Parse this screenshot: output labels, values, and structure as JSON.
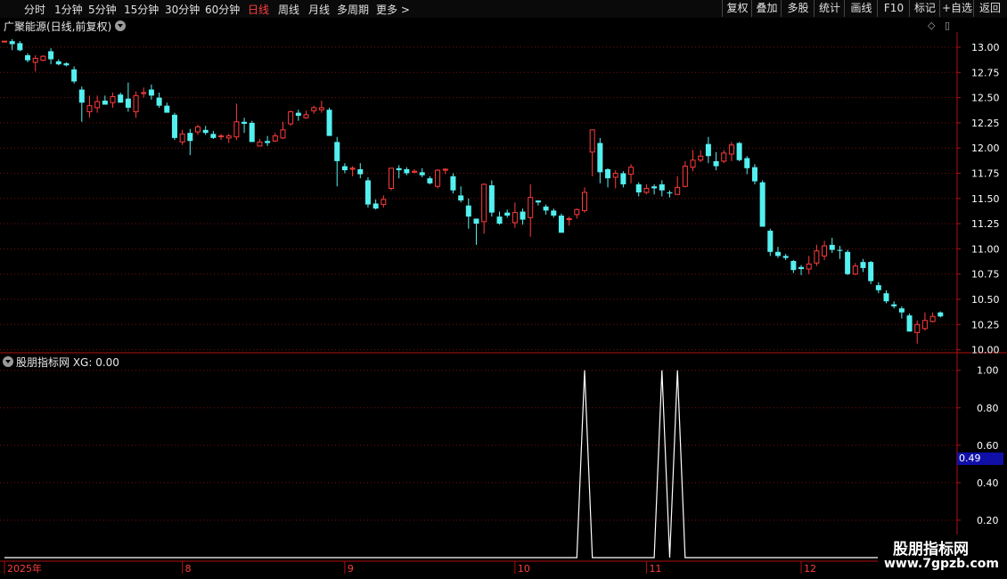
{
  "toolbar": {
    "periods": [
      "分时",
      "1分钟",
      "5分钟",
      "15分钟",
      "30分钟",
      "60分钟",
      "日线",
      "周线",
      "月线",
      "多周期",
      "更多 >"
    ],
    "active_period": "日线",
    "buttons": [
      "复权",
      "叠加",
      "多股",
      "统计",
      "画线",
      "F10",
      "标记",
      "+自选",
      "返回"
    ]
  },
  "main_title": "广聚能源(日线,前复权)",
  "indicator_title": "股朋指标网  XG: 0.00",
  "value_badge": "0.49",
  "watermark": {
    "line1": "股朋指标网",
    "line2": "www.7gpzb.com"
  },
  "colors": {
    "up": "#ff3c3c",
    "down": "#54f0f0",
    "grid": "#7a1010",
    "axis_text": "#ffffff",
    "indicator": "#ffffff",
    "badge": "#1010a8"
  },
  "chart_data": [
    {
      "type": "candlestick",
      "ylim": [
        9.97,
        13.15
      ],
      "yticks": [
        10.0,
        10.25,
        10.5,
        10.75,
        11.0,
        11.25,
        11.5,
        11.75,
        12.0,
        12.25,
        12.5,
        12.75,
        13.0
      ],
      "x_labels": [
        {
          "label": "2025年",
          "index": 0
        },
        {
          "label": "8",
          "index": 23
        },
        {
          "label": "9",
          "index": 44
        },
        {
          "label": "10",
          "index": 66
        },
        {
          "label": "11",
          "index": 83
        },
        {
          "label": "12",
          "index": 103
        }
      ],
      "candles": [
        [
          13.06,
          13.06,
          13.06,
          13.06
        ],
        [
          13.06,
          13.03,
          13.08,
          12.97
        ],
        [
          13.04,
          12.97,
          13.06,
          12.96
        ],
        [
          12.92,
          12.87,
          12.94,
          12.85
        ],
        [
          12.85,
          12.89,
          12.92,
          12.76
        ],
        [
          12.87,
          12.91,
          12.92,
          12.86
        ],
        [
          12.96,
          12.88,
          12.99,
          12.83
        ],
        [
          12.86,
          12.83,
          12.88,
          12.82
        ],
        [
          12.84,
          12.82,
          12.85,
          12.81
        ],
        [
          12.78,
          12.66,
          12.81,
          12.64
        ],
        [
          12.58,
          12.45,
          12.61,
          12.26
        ],
        [
          12.36,
          12.42,
          12.52,
          12.3
        ],
        [
          12.4,
          12.46,
          12.52,
          12.35
        ],
        [
          12.47,
          12.43,
          12.52,
          12.43
        ],
        [
          12.45,
          12.51,
          12.55,
          12.4
        ],
        [
          12.53,
          12.45,
          12.55,
          12.45
        ],
        [
          12.49,
          12.4,
          12.65,
          12.36
        ],
        [
          12.36,
          12.52,
          12.56,
          12.3
        ],
        [
          12.54,
          12.55,
          12.6,
          12.5
        ],
        [
          12.58,
          12.52,
          12.63,
          12.48
        ],
        [
          12.5,
          12.42,
          12.55,
          12.4
        ],
        [
          12.42,
          12.35,
          12.45,
          12.35
        ],
        [
          12.33,
          12.1,
          12.35,
          12.08
        ],
        [
          12.06,
          12.14,
          12.18,
          12.03
        ],
        [
          12.15,
          12.07,
          12.19,
          11.93
        ],
        [
          12.16,
          12.21,
          12.23,
          12.13
        ],
        [
          12.18,
          12.15,
          12.22,
          12.13
        ],
        [
          12.14,
          12.1,
          12.17,
          12.09
        ],
        [
          12.12,
          12.12,
          12.14,
          12.08
        ],
        [
          12.1,
          12.12,
          12.14,
          12.05
        ],
        [
          12.11,
          12.26,
          12.44,
          12.08
        ],
        [
          12.26,
          12.24,
          12.3,
          12.15
        ],
        [
          12.25,
          12.06,
          12.27,
          12.06
        ],
        [
          12.02,
          12.06,
          12.09,
          12.02
        ],
        [
          12.07,
          12.05,
          12.12,
          12.02
        ],
        [
          12.07,
          12.12,
          12.15,
          12.06
        ],
        [
          12.1,
          12.18,
          12.26,
          12.09
        ],
        [
          12.24,
          12.36,
          12.37,
          12.22
        ],
        [
          12.35,
          12.32,
          12.38,
          12.27
        ],
        [
          12.3,
          12.33,
          12.37,
          12.29
        ],
        [
          12.37,
          12.4,
          12.42,
          12.34
        ],
        [
          12.38,
          12.4,
          12.47,
          12.35
        ],
        [
          12.38,
          12.12,
          12.4,
          12.12
        ],
        [
          12.06,
          11.87,
          12.11,
          11.62
        ],
        [
          11.82,
          11.78,
          11.85,
          11.75
        ],
        [
          11.79,
          11.8,
          11.82,
          11.72
        ],
        [
          11.79,
          11.74,
          11.85,
          11.7
        ],
        [
          11.68,
          11.44,
          11.71,
          11.41
        ],
        [
          11.45,
          11.4,
          11.49,
          11.39
        ],
        [
          11.44,
          11.49,
          11.53,
          11.41
        ],
        [
          11.6,
          11.8,
          11.8,
          11.58
        ],
        [
          11.8,
          11.78,
          11.83,
          11.7
        ],
        [
          11.79,
          11.75,
          11.81,
          11.73
        ],
        [
          11.76,
          11.77,
          11.79,
          11.75
        ],
        [
          11.76,
          11.73,
          11.8,
          11.71
        ],
        [
          11.7,
          11.65,
          11.72,
          11.64
        ],
        [
          11.62,
          11.78,
          11.79,
          11.6
        ],
        [
          11.78,
          11.79,
          11.8,
          11.74
        ],
        [
          11.72,
          11.58,
          11.75,
          11.55
        ],
        [
          11.53,
          11.48,
          11.62,
          11.46
        ],
        [
          11.43,
          11.32,
          11.5,
          11.2
        ],
        [
          11.3,
          11.25,
          11.27,
          11.04
        ],
        [
          11.27,
          11.64,
          11.65,
          11.15
        ],
        [
          11.63,
          11.36,
          11.68,
          11.32
        ],
        [
          11.32,
          11.25,
          11.37,
          11.24
        ],
        [
          11.36,
          11.33,
          11.39,
          11.31
        ],
        [
          11.26,
          11.36,
          11.46,
          11.21
        ],
        [
          11.37,
          11.29,
          11.4,
          11.24
        ],
        [
          11.31,
          11.51,
          11.64,
          11.12
        ],
        [
          11.48,
          11.46,
          11.48,
          11.43
        ],
        [
          11.42,
          11.38,
          11.44,
          11.34
        ],
        [
          11.38,
          11.33,
          11.4,
          11.31
        ],
        [
          11.33,
          11.16,
          11.35,
          11.16
        ],
        [
          11.29,
          11.3,
          11.32,
          11.23
        ],
        [
          11.34,
          11.39,
          11.4,
          11.3
        ],
        [
          11.38,
          11.56,
          11.61,
          11.36
        ],
        [
          11.96,
          12.18,
          12.18,
          11.72
        ],
        [
          12.05,
          11.76,
          12.1,
          11.65
        ],
        [
          11.79,
          11.7,
          11.8,
          11.61
        ],
        [
          11.71,
          11.75,
          11.78,
          11.6
        ],
        [
          11.75,
          11.64,
          11.77,
          11.61
        ],
        [
          11.74,
          11.81,
          11.84,
          11.65
        ],
        [
          11.64,
          11.56,
          11.66,
          11.52
        ],
        [
          11.56,
          11.6,
          11.64,
          11.54
        ],
        [
          11.62,
          11.6,
          11.64,
          11.54
        ],
        [
          11.64,
          11.58,
          11.68,
          11.52
        ],
        [
          11.56,
          11.55,
          11.58,
          11.51
        ],
        [
          11.54,
          11.61,
          11.72,
          11.54
        ],
        [
          11.62,
          11.82,
          11.87,
          11.61
        ],
        [
          11.81,
          11.88,
          11.98,
          11.77
        ],
        [
          11.88,
          11.92,
          11.98,
          11.86
        ],
        [
          12.04,
          11.92,
          12.11,
          11.85
        ],
        [
          11.87,
          11.82,
          11.96,
          11.78
        ],
        [
          11.87,
          11.95,
          11.98,
          11.85
        ],
        [
          11.94,
          12.03,
          12.06,
          11.87
        ],
        [
          12.05,
          11.88,
          12.06,
          11.87
        ],
        [
          11.9,
          11.8,
          11.92,
          11.74
        ],
        [
          11.81,
          11.67,
          11.84,
          11.64
        ],
        [
          11.66,
          11.22,
          11.68,
          11.22
        ],
        [
          11.18,
          10.97,
          11.2,
          10.93
        ],
        [
          10.97,
          10.93,
          11.02,
          10.91
        ],
        [
          10.93,
          10.91,
          10.95,
          10.89
        ],
        [
          10.88,
          10.79,
          10.89,
          10.76
        ],
        [
          10.82,
          10.8,
          10.84,
          10.74
        ],
        [
          10.8,
          10.85,
          10.93,
          10.75
        ],
        [
          10.86,
          10.98,
          11.04,
          10.83
        ],
        [
          10.93,
          11.03,
          11.08,
          10.89
        ],
        [
          11.04,
          10.99,
          11.11,
          10.96
        ],
        [
          10.99,
          10.98,
          11.03,
          10.9
        ],
        [
          10.97,
          10.75,
          10.99,
          10.74
        ],
        [
          10.75,
          10.83,
          10.86,
          10.74
        ],
        [
          10.87,
          10.81,
          10.9,
          10.77
        ],
        [
          10.87,
          10.68,
          10.88,
          10.65
        ],
        [
          10.64,
          10.59,
          10.67,
          10.56
        ],
        [
          10.56,
          10.48,
          10.59,
          10.46
        ],
        [
          10.45,
          10.43,
          10.48,
          10.41
        ],
        [
          10.41,
          10.37,
          10.43,
          10.31
        ],
        [
          10.34,
          10.18,
          10.36,
          10.18
        ],
        [
          10.17,
          10.25,
          10.29,
          10.06
        ],
        [
          10.21,
          10.29,
          10.37,
          10.19
        ],
        [
          10.28,
          10.33,
          10.37,
          10.27
        ],
        [
          10.37,
          10.33,
          10.38,
          10.32
        ]
      ]
    },
    {
      "type": "line",
      "name": "XG",
      "ylim": [
        0.0,
        1.07
      ],
      "yticks": [
        0.2,
        0.4,
        0.6,
        0.8,
        1.0
      ],
      "spikes_at_index": [
        75,
        85,
        87
      ],
      "spike_value": 1.0,
      "base_value": 0.0
    }
  ]
}
